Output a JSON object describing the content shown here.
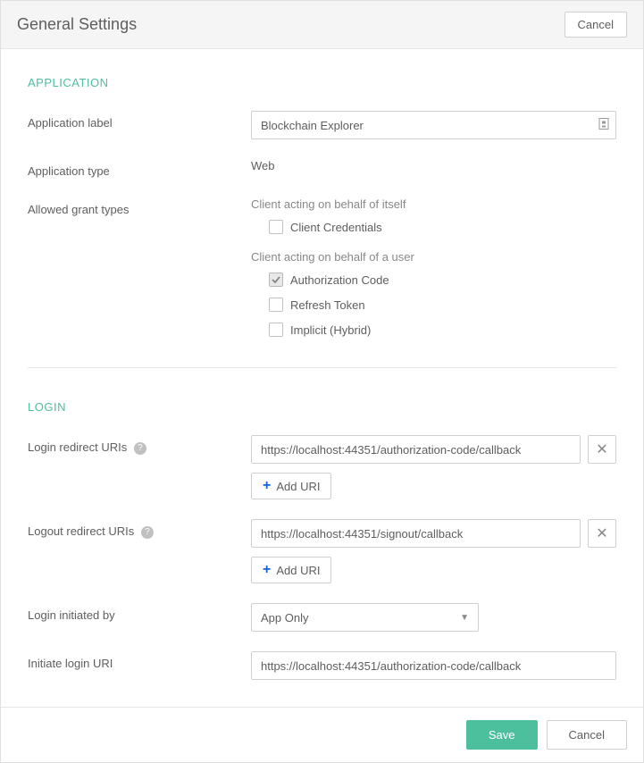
{
  "header": {
    "title": "General Settings",
    "cancel": "Cancel"
  },
  "sections": {
    "application": {
      "title": "APPLICATION",
      "label_field": "Application label",
      "label_value": "Blockchain Explorer",
      "type_field": "Application type",
      "type_value": "Web",
      "grant_field": "Allowed grant types",
      "group_self": "Client acting on behalf of itself",
      "group_user": "Client acting on behalf of a user",
      "grants": {
        "client_credentials": {
          "label": "Client Credentials",
          "checked": false
        },
        "authorization_code": {
          "label": "Authorization Code",
          "checked": true
        },
        "refresh_token": {
          "label": "Refresh Token",
          "checked": false
        },
        "implicit": {
          "label": "Implicit (Hybrid)",
          "checked": false
        }
      }
    },
    "login": {
      "title": "LOGIN",
      "login_redirect_label": "Login redirect URIs",
      "login_redirect_value": "https://localhost:44351/authorization-code/callback",
      "logout_redirect_label": "Logout redirect URIs",
      "logout_redirect_value": "https://localhost:44351/signout/callback",
      "add_uri": "Add URI",
      "initiated_by_label": "Login initiated by",
      "initiated_by_value": "App Only",
      "initiate_uri_label": "Initiate login URI",
      "initiate_uri_value": "https://localhost:44351/authorization-code/callback"
    }
  },
  "footer": {
    "save": "Save",
    "cancel": "Cancel"
  }
}
